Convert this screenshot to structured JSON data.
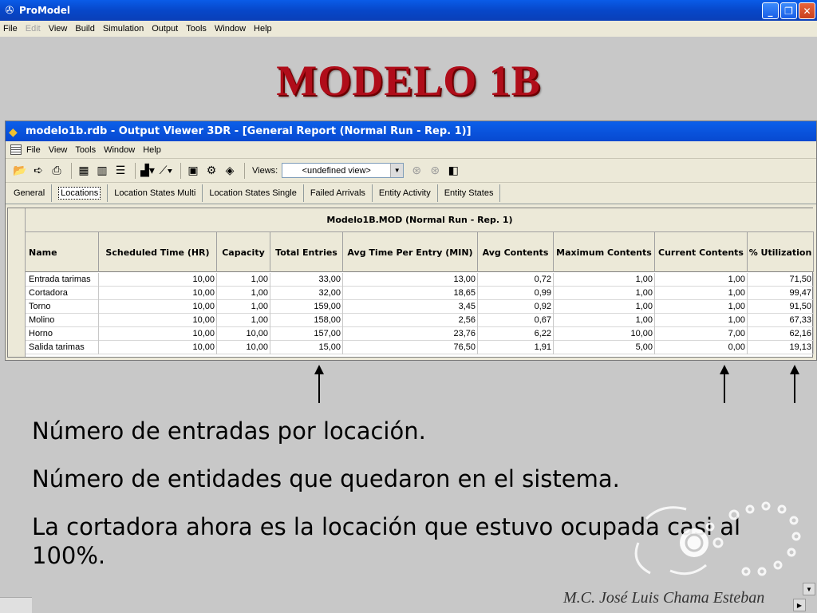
{
  "app": {
    "title": "ProModel",
    "menu": [
      {
        "label": "File",
        "enabled": true
      },
      {
        "label": "Edit",
        "enabled": false
      },
      {
        "label": "View",
        "enabled": true
      },
      {
        "label": "Build",
        "enabled": true
      },
      {
        "label": "Simulation",
        "enabled": true
      },
      {
        "label": "Output",
        "enabled": true
      },
      {
        "label": "Tools",
        "enabled": true
      },
      {
        "label": "Window",
        "enabled": true
      },
      {
        "label": "Help",
        "enabled": true
      }
    ]
  },
  "slide": {
    "title": "MODELO 1B",
    "bullets": [
      "Número de entradas por locación.",
      "Número de entidades que quedaron en el sistema.",
      "La cortadora ahora es la locación que estuvo ocupada casi al 100%."
    ],
    "author": "M.C. José Luis Chama Esteban",
    "accent_color": "#b00d1a"
  },
  "viewer": {
    "title": "modelo1b.rdb - Output Viewer 3DR - [General Report (Normal Run - Rep. 1)]",
    "menu": [
      "File",
      "View",
      "Tools",
      "Window",
      "Help"
    ],
    "views_label": "Views:",
    "views_value": "<undefined view>",
    "tabs": [
      {
        "label": "General",
        "active": false
      },
      {
        "label": "Locations",
        "active": true
      },
      {
        "label": "Location States Multi",
        "active": false
      },
      {
        "label": "Location States Single",
        "active": false
      },
      {
        "label": "Failed Arrivals",
        "active": false
      },
      {
        "label": "Entity Activity",
        "active": false
      },
      {
        "label": "Entity States",
        "active": false
      }
    ],
    "table": {
      "caption": "Modelo1B.MOD (Normal Run - Rep. 1)",
      "headers": [
        "Name",
        "Scheduled Time (HR)",
        "Capacity",
        "Total Entries",
        "Avg Time Per Entry (MIN)",
        "Avg Contents",
        "Maximum Contents",
        "Current Contents",
        "% Utilization"
      ],
      "rows": [
        [
          "Entrada tarimas",
          "10,00",
          "1,00",
          "33,00",
          "13,00",
          "0,72",
          "1,00",
          "1,00",
          "71,50"
        ],
        [
          "Cortadora",
          "10,00",
          "1,00",
          "32,00",
          "18,65",
          "0,99",
          "1,00",
          "1,00",
          "99,47"
        ],
        [
          "Torno",
          "10,00",
          "1,00",
          "159,00",
          "3,45",
          "0,92",
          "1,00",
          "1,00",
          "91,50"
        ],
        [
          "Molino",
          "10,00",
          "1,00",
          "158,00",
          "2,56",
          "0,67",
          "1,00",
          "1,00",
          "67,33"
        ],
        [
          "Horno",
          "10,00",
          "10,00",
          "157,00",
          "23,76",
          "6,22",
          "10,00",
          "7,00",
          "62,16"
        ],
        [
          "Salida tarimas",
          "10,00",
          "10,00",
          "15,00",
          "76,50",
          "1,91",
          "5,00",
          "0,00",
          "19,13"
        ]
      ]
    }
  }
}
